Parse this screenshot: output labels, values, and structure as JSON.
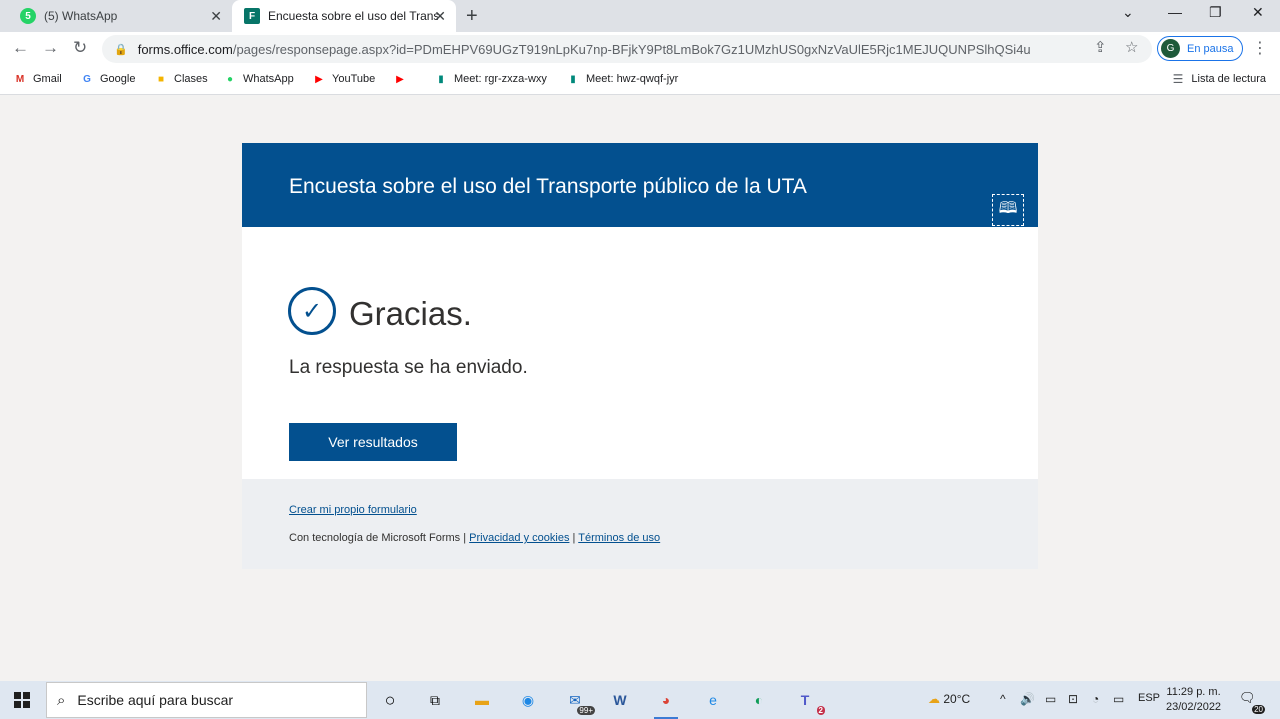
{
  "browser": {
    "tabs": [
      {
        "title": "(5) WhatsApp",
        "icon": "whatsapp-icon",
        "icon_color": "#25d366",
        "badge": "5"
      },
      {
        "title": "Encuesta sobre el uso del Transp",
        "icon": "forms-icon",
        "icon_color": "#077568",
        "badge": "F"
      }
    ],
    "url_host": "forms.office.com",
    "url_path": "/pages/responsepage.aspx?id=PDmEHPV69UGzT919nLpKu7np-BFjkY9Pt8LmBok7Gz1UMzhUS0gxNzVaUlE5Rjc1MEJUQUNPSlhQSi4u",
    "profile_initial": "G",
    "profile_label": "En pausa"
  },
  "bookmarks": [
    {
      "label": "Gmail",
      "icon": "gmail-icon",
      "glyph": "M",
      "color": "#d93025"
    },
    {
      "label": "Google",
      "icon": "google-icon",
      "glyph": "G",
      "color": "#4285f4"
    },
    {
      "label": "Clases",
      "icon": "classroom-icon",
      "glyph": "■",
      "color": "#f4b400"
    },
    {
      "label": "WhatsApp",
      "icon": "whatsapp-icon",
      "glyph": "●",
      "color": "#25d366"
    },
    {
      "label": "YouTube",
      "icon": "youtube-icon",
      "glyph": "▶",
      "color": "#ff0000"
    },
    {
      "label": "",
      "icon": "youtube-icon",
      "glyph": "▶",
      "color": "#ff0000"
    },
    {
      "label": "Meet: rgr-zxza-wxy",
      "icon": "meet-icon",
      "glyph": "▮",
      "color": "#00897b"
    },
    {
      "label": "Meet: hwz-qwqf-jyr",
      "icon": "meet-icon",
      "glyph": "▮",
      "color": "#00897b"
    }
  ],
  "reading_list": "Lista de lectura",
  "form": {
    "title": "Encuesta sobre el uso del Transporte público de la UTA",
    "thanks": "Gracias.",
    "message": "La respuesta se ha enviado.",
    "results_button": "Ver resultados",
    "create_own": "Crear mi propio formulario",
    "powered_by": "Con tecnología de Microsoft Forms |",
    "privacy": "Privacidad y cookies",
    "separator": "|",
    "terms": "Términos de uso",
    "brand_color": "#03508f"
  },
  "taskbar": {
    "search_placeholder": "Escribe aquí para buscar",
    "mail_badge": "99+",
    "teams_badge": "2",
    "weather": "20°C",
    "language": "ESP",
    "time": "11:29 p. m.",
    "date": "23/02/2022",
    "notifications": "20"
  }
}
